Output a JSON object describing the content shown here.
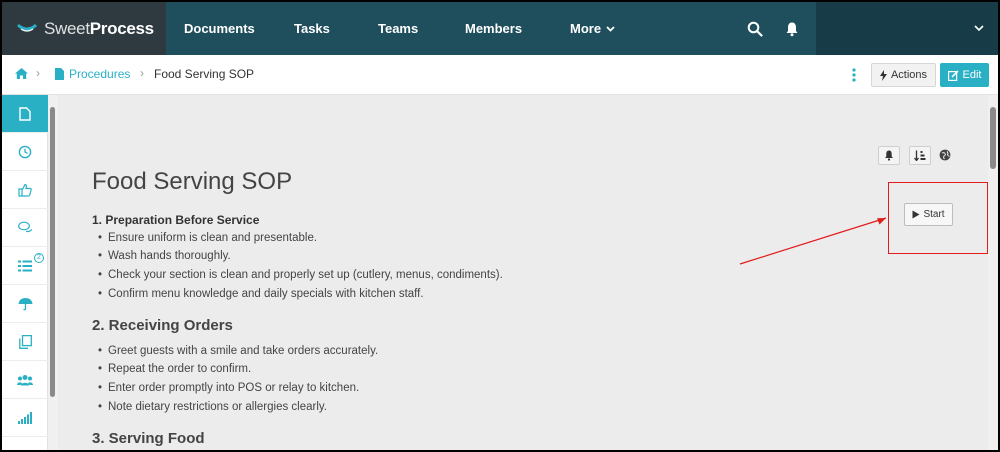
{
  "app": {
    "logo_sweet": "Sweet",
    "logo_process": "Process"
  },
  "topnav": {
    "items": [
      "Documents",
      "Tasks",
      "Teams",
      "Members",
      "More"
    ]
  },
  "breadcrumb": {
    "procedures": "Procedures",
    "current": "Food Serving SOP"
  },
  "toolbar": {
    "actions_label": "Actions",
    "edit_label": "Edit"
  },
  "rail": {
    "badge_count": "2",
    "icons": [
      "document-icon",
      "clock-icon",
      "thumbs-up-icon",
      "chat-icon",
      "checklist-icon",
      "umbrella-icon",
      "copy-icon",
      "team-icon",
      "chart-icon"
    ]
  },
  "doc": {
    "title": "Food Serving SOP",
    "start_label": "Start",
    "section1_title": "1. Preparation Before Service",
    "section1_items": [
      "Ensure uniform is clean and presentable.",
      "Wash hands thoroughly.",
      "Check your section is clean and properly set up (cutlery, menus, condiments).",
      "Confirm menu knowledge and daily specials with kitchen staff."
    ],
    "section2_title": "2. Receiving Orders",
    "section2_items": [
      "Greet guests with a smile and take orders accurately.",
      "Repeat the order to confirm.",
      "Enter order promptly into POS or relay to kitchen.",
      "Note dietary restrictions or allergies clearly."
    ],
    "section3_title": "3. Serving Food"
  },
  "colors": {
    "brand_teal": "#2ab0c5",
    "nav_bg": "#1f4f5d",
    "highlight_red": "#e31b1b"
  }
}
